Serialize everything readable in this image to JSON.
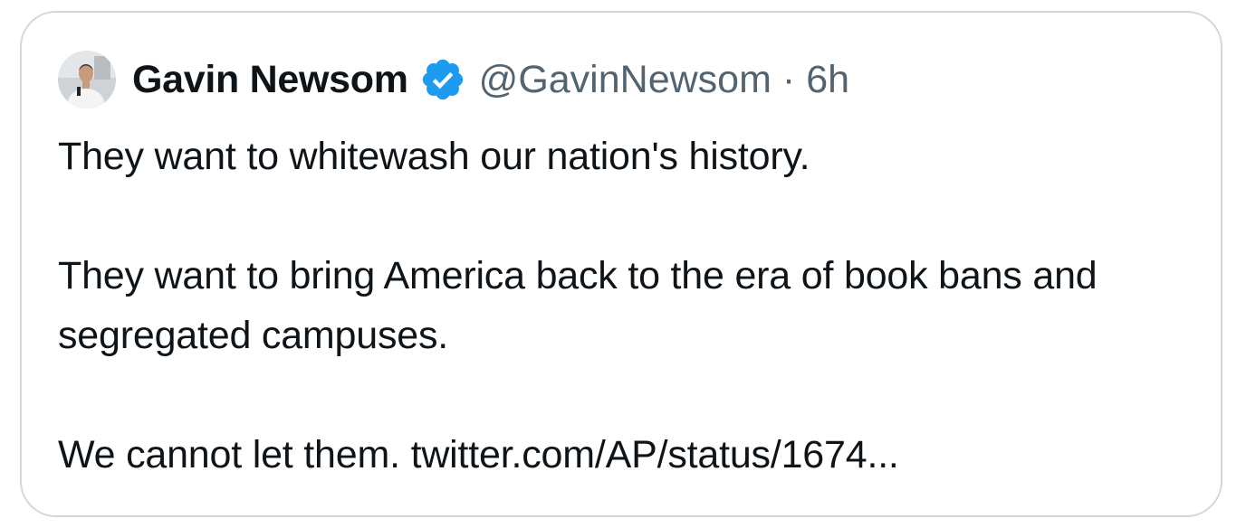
{
  "tweet": {
    "display_name": "Gavin Newsom",
    "handle": "@GavinNewsom",
    "separator": "·",
    "time": "6h",
    "verified_icon": "verified-badge-icon",
    "verified_color": "#1d9bf0",
    "avatar_icon": "profile-photo",
    "paragraphs": [
      "They want to whitewash our nation's history.",
      "They want to bring America back to the era of book bans and segregated campuses.",
      "We cannot let them. twitter.com/AP/status/1674..."
    ]
  }
}
